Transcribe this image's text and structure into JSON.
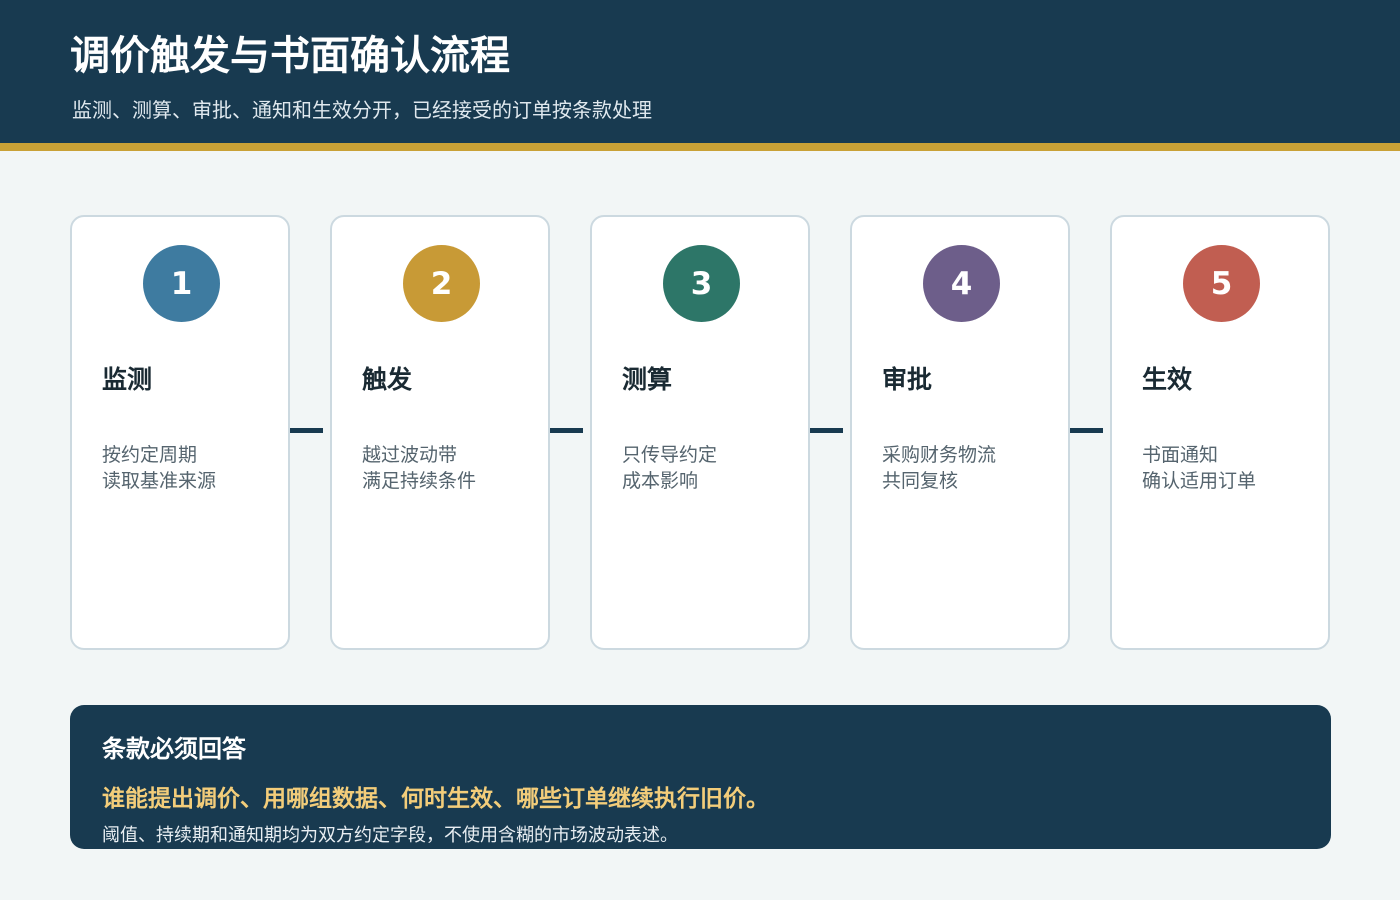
{
  "header": {
    "title": "调价触发与书面确认流程",
    "subtitle": "监测、测算、审批、通知和生效分开，已经接受的订单按条款处理"
  },
  "colors": {
    "header_bg": "#183a50",
    "accent_stripe": "#c9a136",
    "highlight_text": "#f3cd7a"
  },
  "steps": [
    {
      "number": "1",
      "title": "监测",
      "lines": [
        "按约定周期",
        "读取基准来源"
      ],
      "color": "#3e7ba0"
    },
    {
      "number": "2",
      "title": "触发",
      "lines": [
        "越过波动带",
        "满足持续条件"
      ],
      "color": "#c89a36"
    },
    {
      "number": "3",
      "title": "测算",
      "lines": [
        "只传导约定",
        "成本影响"
      ],
      "color": "#2d7668"
    },
    {
      "number": "4",
      "title": "审批",
      "lines": [
        "采购财务物流",
        "共同复核"
      ],
      "color": "#6d5e8a"
    },
    {
      "number": "5",
      "title": "生效",
      "lines": [
        "书面通知",
        "确认适用订单"
      ],
      "color": "#c15e51"
    }
  ],
  "note": {
    "heading": "条款必须回答",
    "highlight": "谁能提出调价、用哪组数据、何时生效、哪些订单继续执行旧价。",
    "body": "阈值、持续期和通知期均为双方约定字段，不使用含糊的市场波动表述。"
  }
}
